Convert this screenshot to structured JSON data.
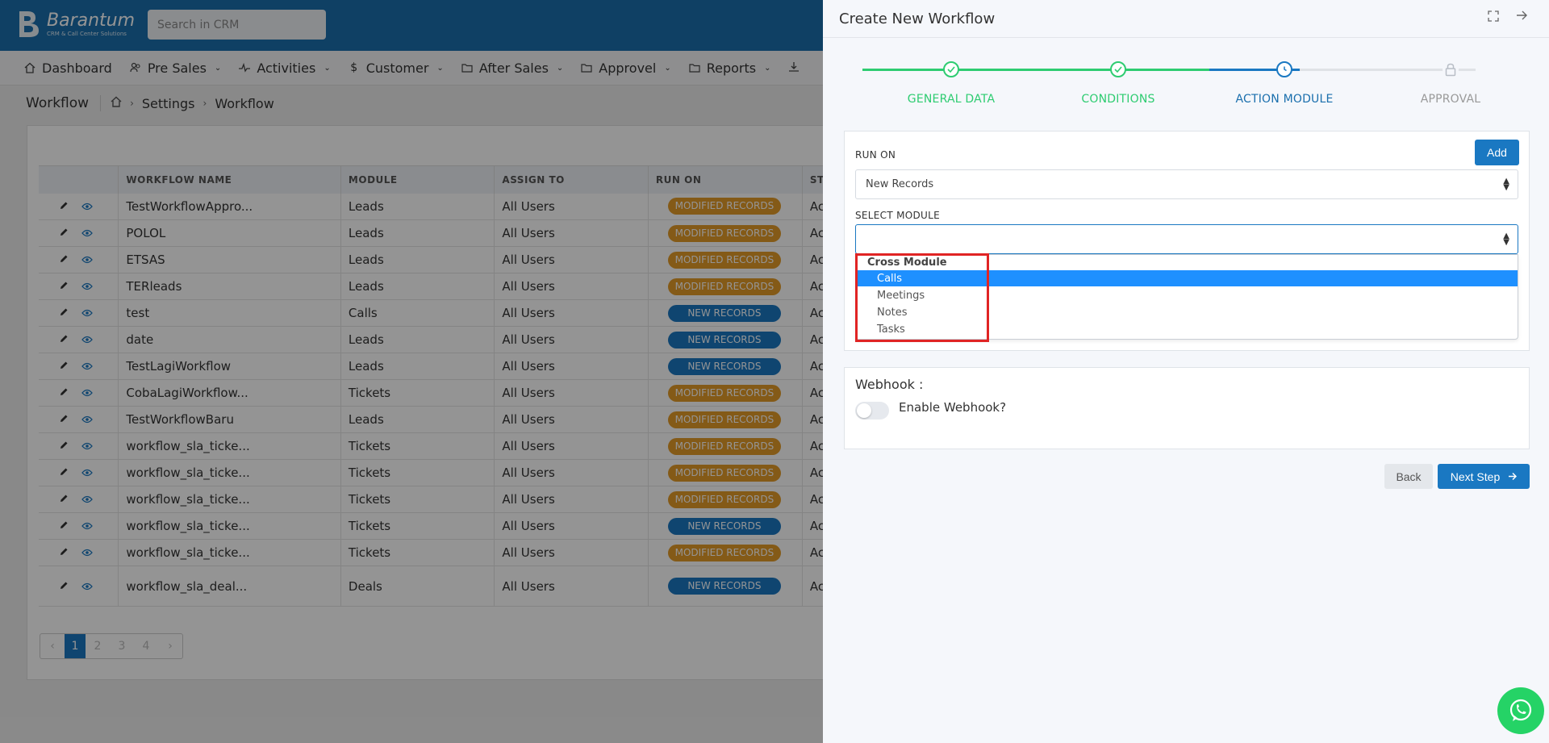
{
  "app": {
    "logo_name": "Barantum",
    "logo_tagline": "CRM & Call Center Solutions",
    "search_placeholder": "Search in CRM"
  },
  "nav": [
    {
      "label": "Dashboard",
      "icon": "home-icon",
      "has_chevron": false
    },
    {
      "label": "Pre Sales",
      "icon": "users-icon",
      "has_chevron": true
    },
    {
      "label": "Activities",
      "icon": "pulse-icon",
      "has_chevron": true
    },
    {
      "label": "Customer",
      "icon": "dollar-icon",
      "has_chevron": true
    },
    {
      "label": "After Sales",
      "icon": "folder-icon",
      "has_chevron": true
    },
    {
      "label": "Approvel",
      "icon": "folder-icon",
      "has_chevron": true
    },
    {
      "label": "Reports",
      "icon": "folder-icon",
      "has_chevron": true
    }
  ],
  "breadcrumb": {
    "title": "Workflow",
    "items": [
      "Settings",
      "Workflow"
    ]
  },
  "table": {
    "headers": [
      "",
      "WORKFLOW NAME",
      "MODULE",
      "ASSIGN TO",
      "RUN ON",
      "ST"
    ],
    "rows": [
      {
        "name": "TestWorkflowAppro...",
        "module": "Leads",
        "assign": "All Users",
        "run_on": "MODIFIED RECORDS",
        "type": "mod",
        "status": "Act"
      },
      {
        "name": "POLOL",
        "module": "Leads",
        "assign": "All Users",
        "run_on": "MODIFIED RECORDS",
        "type": "mod",
        "status": "Act"
      },
      {
        "name": "ETSAS",
        "module": "Leads",
        "assign": "All Users",
        "run_on": "MODIFIED RECORDS",
        "type": "mod",
        "status": "Act"
      },
      {
        "name": "TERleads",
        "module": "Leads",
        "assign": "All Users",
        "run_on": "MODIFIED RECORDS",
        "type": "mod",
        "status": "Act"
      },
      {
        "name": "test",
        "module": "Calls",
        "assign": "All Users",
        "run_on": "NEW RECORDS",
        "type": "new",
        "status": "Act"
      },
      {
        "name": "date",
        "module": "Leads",
        "assign": "All Users",
        "run_on": "NEW RECORDS",
        "type": "new",
        "status": "Act"
      },
      {
        "name": "TestLagiWorkflow",
        "module": "Leads",
        "assign": "All Users",
        "run_on": "NEW RECORDS",
        "type": "new",
        "status": "Act"
      },
      {
        "name": "CobaLagiWorkflow...",
        "module": "Tickets",
        "assign": "All Users",
        "run_on": "MODIFIED RECORDS",
        "type": "mod",
        "status": "Act"
      },
      {
        "name": "TestWorkflowBaru",
        "module": "Leads",
        "assign": "All Users",
        "run_on": "MODIFIED RECORDS",
        "type": "mod",
        "status": "Act"
      },
      {
        "name": "workflow_sla_ticke...",
        "module": "Tickets",
        "assign": "All Users",
        "run_on": "MODIFIED RECORDS",
        "type": "mod",
        "status": "Act"
      },
      {
        "name": "workflow_sla_ticke...",
        "module": "Tickets",
        "assign": "All Users",
        "run_on": "MODIFIED RECORDS",
        "type": "mod",
        "status": "Act"
      },
      {
        "name": "workflow_sla_ticke...",
        "module": "Tickets",
        "assign": "All Users",
        "run_on": "MODIFIED RECORDS",
        "type": "mod",
        "status": "Act"
      },
      {
        "name": "workflow_sla_ticke...",
        "module": "Tickets",
        "assign": "All Users",
        "run_on": "NEW RECORDS",
        "type": "new",
        "status": "Act"
      },
      {
        "name": "workflow_sla_ticke...",
        "module": "Tickets",
        "assign": "All Users",
        "run_on": "MODIFIED RECORDS",
        "type": "mod",
        "status": "Act"
      },
      {
        "name": "workflow_sla_deal...",
        "module": "Deals",
        "assign": "All Users",
        "run_on": "NEW RECORDS",
        "type": "new",
        "status": "Act",
        "tall": true
      }
    ]
  },
  "pagination": {
    "prev": "‹",
    "pages": [
      "1",
      "2",
      "3",
      "4"
    ],
    "next": "›",
    "current": "1"
  },
  "panel": {
    "title": "Create New Workflow",
    "steps": [
      {
        "label": "GENERAL DATA",
        "state": "done"
      },
      {
        "label": "CONDITIONS",
        "state": "done"
      },
      {
        "label": "ACTION MODULE",
        "state": "current"
      },
      {
        "label": "APPROVAL",
        "state": "locked"
      }
    ],
    "run_on_label": "RUN ON",
    "add_button": "Add",
    "run_on_value": "New Records",
    "select_module_label": "SELECT MODULE",
    "select_module_value": "",
    "dropdown": {
      "group": "Cross Module",
      "options": [
        "Calls",
        "Meetings",
        "Notes",
        "Tasks"
      ],
      "selected": "Calls"
    },
    "webhook_title": "Webhook :",
    "webhook_toggle_label": "Enable Webhook?",
    "webhook_enabled": false,
    "back_button": "Back",
    "next_button": "Next Step"
  },
  "colors": {
    "brand": "#1a6fad",
    "primary": "#1a78c2",
    "done": "#2ecc71",
    "modified_badge": "#e39b29",
    "highlight": "#e02424",
    "whatsapp": "#25d366"
  }
}
